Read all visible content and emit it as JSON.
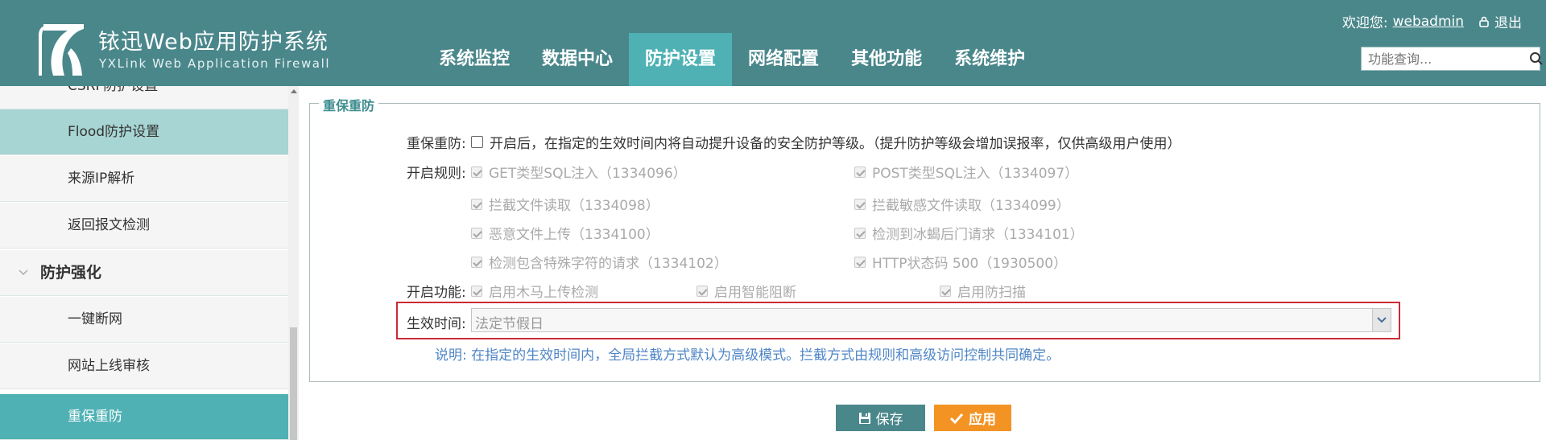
{
  "header": {
    "brand_cn": "铱迅Web应用防护系统",
    "brand_en": "YXLink Web Application Firewall",
    "nav": [
      {
        "label": "系统监控",
        "active": false
      },
      {
        "label": "数据中心",
        "active": false
      },
      {
        "label": "防护设置",
        "active": true
      },
      {
        "label": "网络配置",
        "active": false
      },
      {
        "label": "其他功能",
        "active": false
      },
      {
        "label": "系统维护",
        "active": false
      }
    ],
    "welcome": "欢迎您:",
    "username": "webadmin",
    "logout": "退出",
    "search_placeholder": "功能查询..."
  },
  "sidebar": {
    "items": [
      {
        "label": "CSRF防护设置"
      },
      {
        "label": "Flood防护设置"
      },
      {
        "label": "来源IP解析"
      },
      {
        "label": "返回报文检测"
      }
    ],
    "group": "防护强化",
    "group_items": [
      {
        "label": "一键断网"
      },
      {
        "label": "网站上线审核"
      },
      {
        "label": "重保重防"
      }
    ]
  },
  "panel": {
    "legend": "重保重防",
    "toggle_label": "重保重防:",
    "toggle_text": "开启后，在指定的生效时间内将自动提升设备的安全防护等级。（提升防护等级会增加误报率，仅供高级用户使用）",
    "rules_label": "开启规则:",
    "rules": [
      "GET类型SQL注入（1334096）",
      "POST类型SQL注入（1334097）",
      "拦截文件读取（1334098）",
      "拦截敏感文件读取（1334099）",
      "恶意文件上传（1334100）",
      "检测到冰蝎后门请求（1334101）",
      "检测包含特殊字符的请求（1334102）",
      "HTTP状态码 500（1930500）"
    ],
    "features_label": "开启功能:",
    "features": [
      "启用木马上传检测",
      "启用智能阻断",
      "启用防扫描"
    ],
    "time_label": "生效时间:",
    "time_value": "法定节假日",
    "note": "说明: 在指定的生效时间内，全局拦截方式默认为高级模式。拦截方式由规则和高级访问控制共同确定。"
  },
  "buttons": {
    "save": "保存",
    "apply": "应用"
  },
  "colors": {
    "header_bg": "#4a878b",
    "active_tab": "#4fb1b4",
    "highlight_red": "#cc2b36",
    "apply_orange": "#f39324",
    "note_blue": "#4f86c6"
  }
}
